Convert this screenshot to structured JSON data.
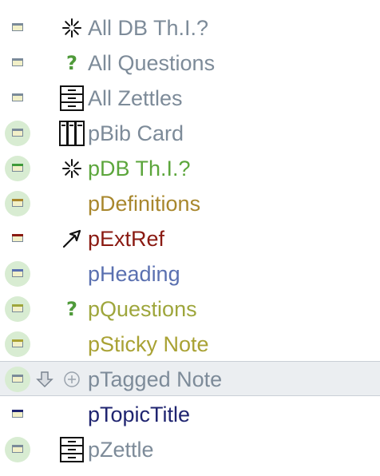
{
  "rows": [
    {
      "label": "All DB Th.I.?",
      "color": "#7d8b99",
      "icon": "sparkle-icon",
      "status": "none"
    },
    {
      "label": "All Questions",
      "color": "#7d8b99",
      "icon": "question-icon",
      "status": "none"
    },
    {
      "label": "All Zettles",
      "color": "#7d8b99",
      "icon": "cabinet-icon",
      "status": "none"
    },
    {
      "label": "pBib Card",
      "color": "#7d8b99",
      "icon": "books-icon",
      "status": "green"
    },
    {
      "label": "pDB Th.I.?",
      "color": "#5ca63c",
      "icon": "sparkle-icon",
      "status": "green"
    },
    {
      "label": "pDefinitions",
      "color": "#a8872d",
      "icon": "",
      "status": "green"
    },
    {
      "label": "pExtRef",
      "color": "#8a1a12",
      "icon": "arrow-icon",
      "status": "none"
    },
    {
      "label": "pHeading",
      "color": "#5a70b0",
      "icon": "",
      "status": "green"
    },
    {
      "label": "pQuestions",
      "color": "#9ea63c",
      "icon": "question-icon",
      "status": "green"
    },
    {
      "label": "pSticky Note",
      "color": "#a9a234",
      "icon": "",
      "status": "green"
    },
    {
      "label": "pTagged Note",
      "color": "#7d8b99",
      "icon": "",
      "status": "green",
      "selected": true
    },
    {
      "label": "pTopicTitle",
      "color": "#1f2470",
      "icon": "",
      "status": "none"
    },
    {
      "label": "pZettle",
      "color": "#7d8b99",
      "icon": "cabinet-icon",
      "status": "green"
    }
  ],
  "window_bar_colors": [
    "#7a8a99",
    "#7a8a99",
    "#7a8a99",
    "#7a8a99",
    "#3f9a3a",
    "#a8872d",
    "#8a1a12",
    "#5a70b0",
    "#9ea63c",
    "#a9a234",
    "#7a8a99",
    "#1f2470",
    "#7a8a99"
  ],
  "selected_row_icons": [
    "drag-handle-icon",
    "add-icon"
  ]
}
